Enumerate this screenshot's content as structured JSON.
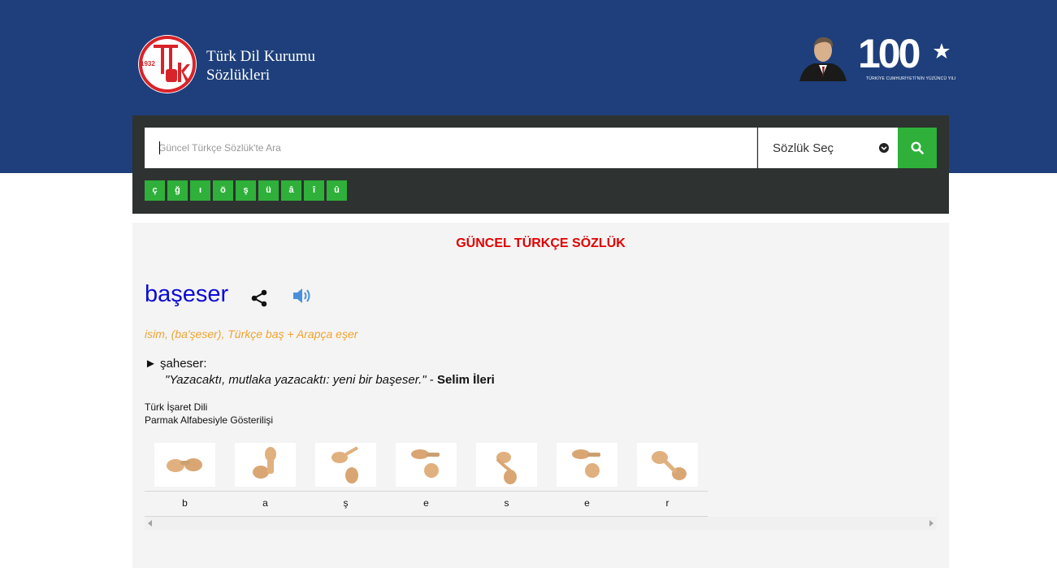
{
  "brand": {
    "logo_year": "1932",
    "line1": "Türk Dil Kurumu",
    "line2": "Sözlükleri",
    "centennial_number": "100",
    "centennial_tagline": "TÜRKİYE CUMHURİYETİ'NİN YÜZÜNCÜ YILI"
  },
  "search": {
    "placeholder": "Güncel Türkçe Sözlük'te Ara",
    "value": "",
    "select_label": "Sözlük Seç",
    "special_letters": [
      "ç",
      "ğ",
      "ı",
      "ö",
      "ş",
      "ü",
      "â",
      "î",
      "û"
    ]
  },
  "result": {
    "dictionary_title": "GÜNCEL TÜRKÇE SÖZLÜK",
    "word": "başeser",
    "meta": "isim, (ba'şeser), Türkçe baş + Arapça eşer",
    "meaning_marker": "►",
    "meaning": "şaheser:",
    "example_text": "\"Yazacaktı, mutlaka yazacaktı: yeni bir başeser.\"",
    "example_separator": " - ",
    "example_author": "Selim İleri",
    "sign_language_title": "Türk İşaret Dili",
    "sign_language_subtitle": "Parmak Alfabesiyle Gösterilişi",
    "sign_letters": [
      "b",
      "a",
      "ş",
      "e",
      "s",
      "e",
      "r"
    ]
  },
  "colors": {
    "header_bg": "#1e3f7b",
    "panel_bg": "#2e3230",
    "accent_green": "#2fb03a",
    "title_red": "#e00000",
    "word_blue": "#0b0bd8",
    "meta_orange": "#f0a330"
  },
  "icons": {
    "share": "share-icon",
    "sound": "speaker-icon",
    "search": "search-icon",
    "dropdown": "chevron-down-icon"
  }
}
